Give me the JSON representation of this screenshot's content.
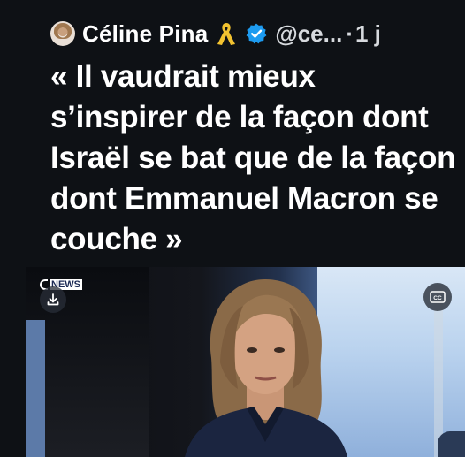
{
  "tweet": {
    "author_name": "Céline Pina",
    "handle": "@ce...",
    "separator": "·",
    "time": "1 j",
    "text": "« Il vaudrait mieux s’inspirer de la façon dont Israël se bat que de la façon dont Emmanuel Macron se couche »",
    "icons": {
      "avatar": "profile-photo",
      "ribbon": "yellow-ribbon-icon",
      "verified": "verified-badge-icon"
    }
  },
  "media": {
    "channel_logo": "NEWS",
    "icons": {
      "download": "download-icon",
      "captions": "closed-captions-icon"
    },
    "cc_label": "CC"
  },
  "colors": {
    "background": "#0e1115",
    "text": "#ffffff",
    "secondary_text": "#d7dade",
    "verified": "#1d9bf0",
    "ribbon": "#f2c230"
  }
}
